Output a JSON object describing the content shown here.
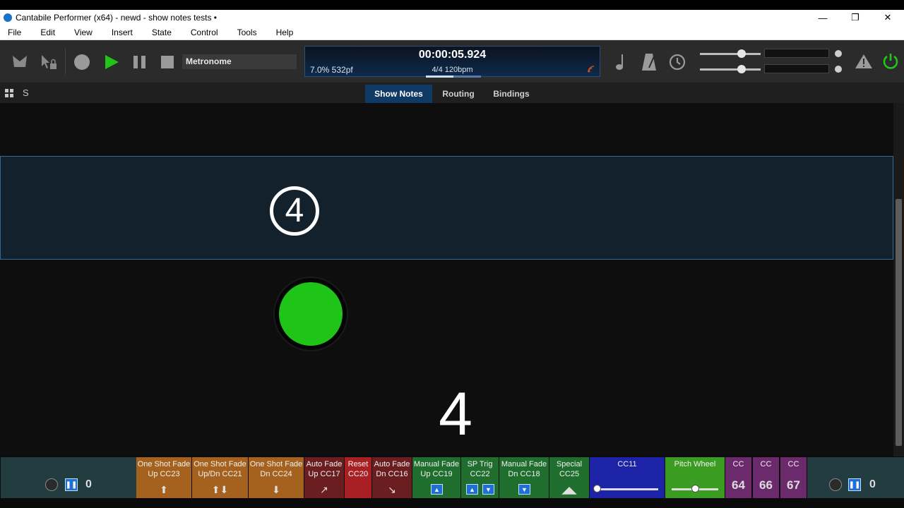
{
  "window": {
    "title": "Cantabile Performer (x64) - newd - show notes tests •",
    "min_glyph": "—",
    "max_glyph": "❐",
    "close_glyph": "✕"
  },
  "menu": [
    "File",
    "Edit",
    "View",
    "Insert",
    "State",
    "Control",
    "Tools",
    "Help"
  ],
  "toolbar": {
    "song_name": "Metronome",
    "icons": [
      "background-icon",
      "pointer-lock-icon",
      "record-icon",
      "play-icon",
      "pause-icon",
      "stop-icon",
      "note-icon",
      "metronome-icon",
      "clock-icon",
      "warning-icon",
      "power-icon"
    ],
    "accent_play": "#22c51a",
    "accent_power": "#22c51a"
  },
  "transport": {
    "time": "00:00:05.924",
    "load": "7.0%  532pf",
    "tempo": "4/4 120bpm",
    "beat_progress": 0.5
  },
  "levels": [
    {
      "name": "main",
      "level": 0.72
    },
    {
      "name": "secondary",
      "level": 0.72
    }
  ],
  "tabs": {
    "views_icon": "grid-icon",
    "s_label": "S",
    "items": [
      "Show Notes",
      "Routing",
      "Bindings"
    ],
    "active": "Show Notes"
  },
  "notes": {
    "circled": "4",
    "big_number": "4",
    "indicator_color": "#1fc418"
  },
  "bottom": {
    "left": {
      "value": "0"
    },
    "right": {
      "value": "0"
    },
    "panels": [
      {
        "line1": "One Shot Fade",
        "line2": "Up CC23",
        "glyph": "⬆",
        "color": "#a5621f"
      },
      {
        "line1": "One Shot Fade",
        "line2": "Up/Dn CC21",
        "glyph": "⬆⬇",
        "color": "#a5621f"
      },
      {
        "line1": "One Shot Fade",
        "line2": "Dn CC24",
        "glyph": "⬇",
        "color": "#a5621f"
      },
      {
        "line1": "Auto Fade",
        "line2": "Up CC17",
        "glyph": "↗",
        "color": "#6b1e20"
      },
      {
        "line1": "Reset",
        "line2": "CC20",
        "glyph": "",
        "color": "#a82024"
      },
      {
        "line1": "Auto Fade",
        "line2": "Dn CC16",
        "glyph": "↘",
        "color": "#6b1e20"
      },
      {
        "line1": "Manual Fade",
        "line2": "Up CC19",
        "glyph": "▲",
        "color": "#1f6e2e"
      },
      {
        "line1": "SP Trig",
        "line2": "CC22",
        "glyph": "▲▼",
        "color": "#1f6e2e"
      },
      {
        "line1": "Manual Fade",
        "line2": "Dn CC18",
        "glyph": "▼",
        "color": "#1f6e2e"
      },
      {
        "line1": "Special",
        "line2": "CC25",
        "glyph": "◢◣",
        "color": "#1f6e2e"
      }
    ],
    "cc11": {
      "label": "CC11",
      "level": 0.0,
      "color": "#1d23a6"
    },
    "pitch": {
      "label": "Pitch Wheel",
      "level": 0.5,
      "color": "#3b9c22"
    },
    "cc_buttons": [
      {
        "label": "CC",
        "value": "64"
      },
      {
        "label": "CC",
        "value": "66"
      },
      {
        "label": "CC",
        "value": "67"
      }
    ],
    "cc_color": "#6b2a6c"
  }
}
